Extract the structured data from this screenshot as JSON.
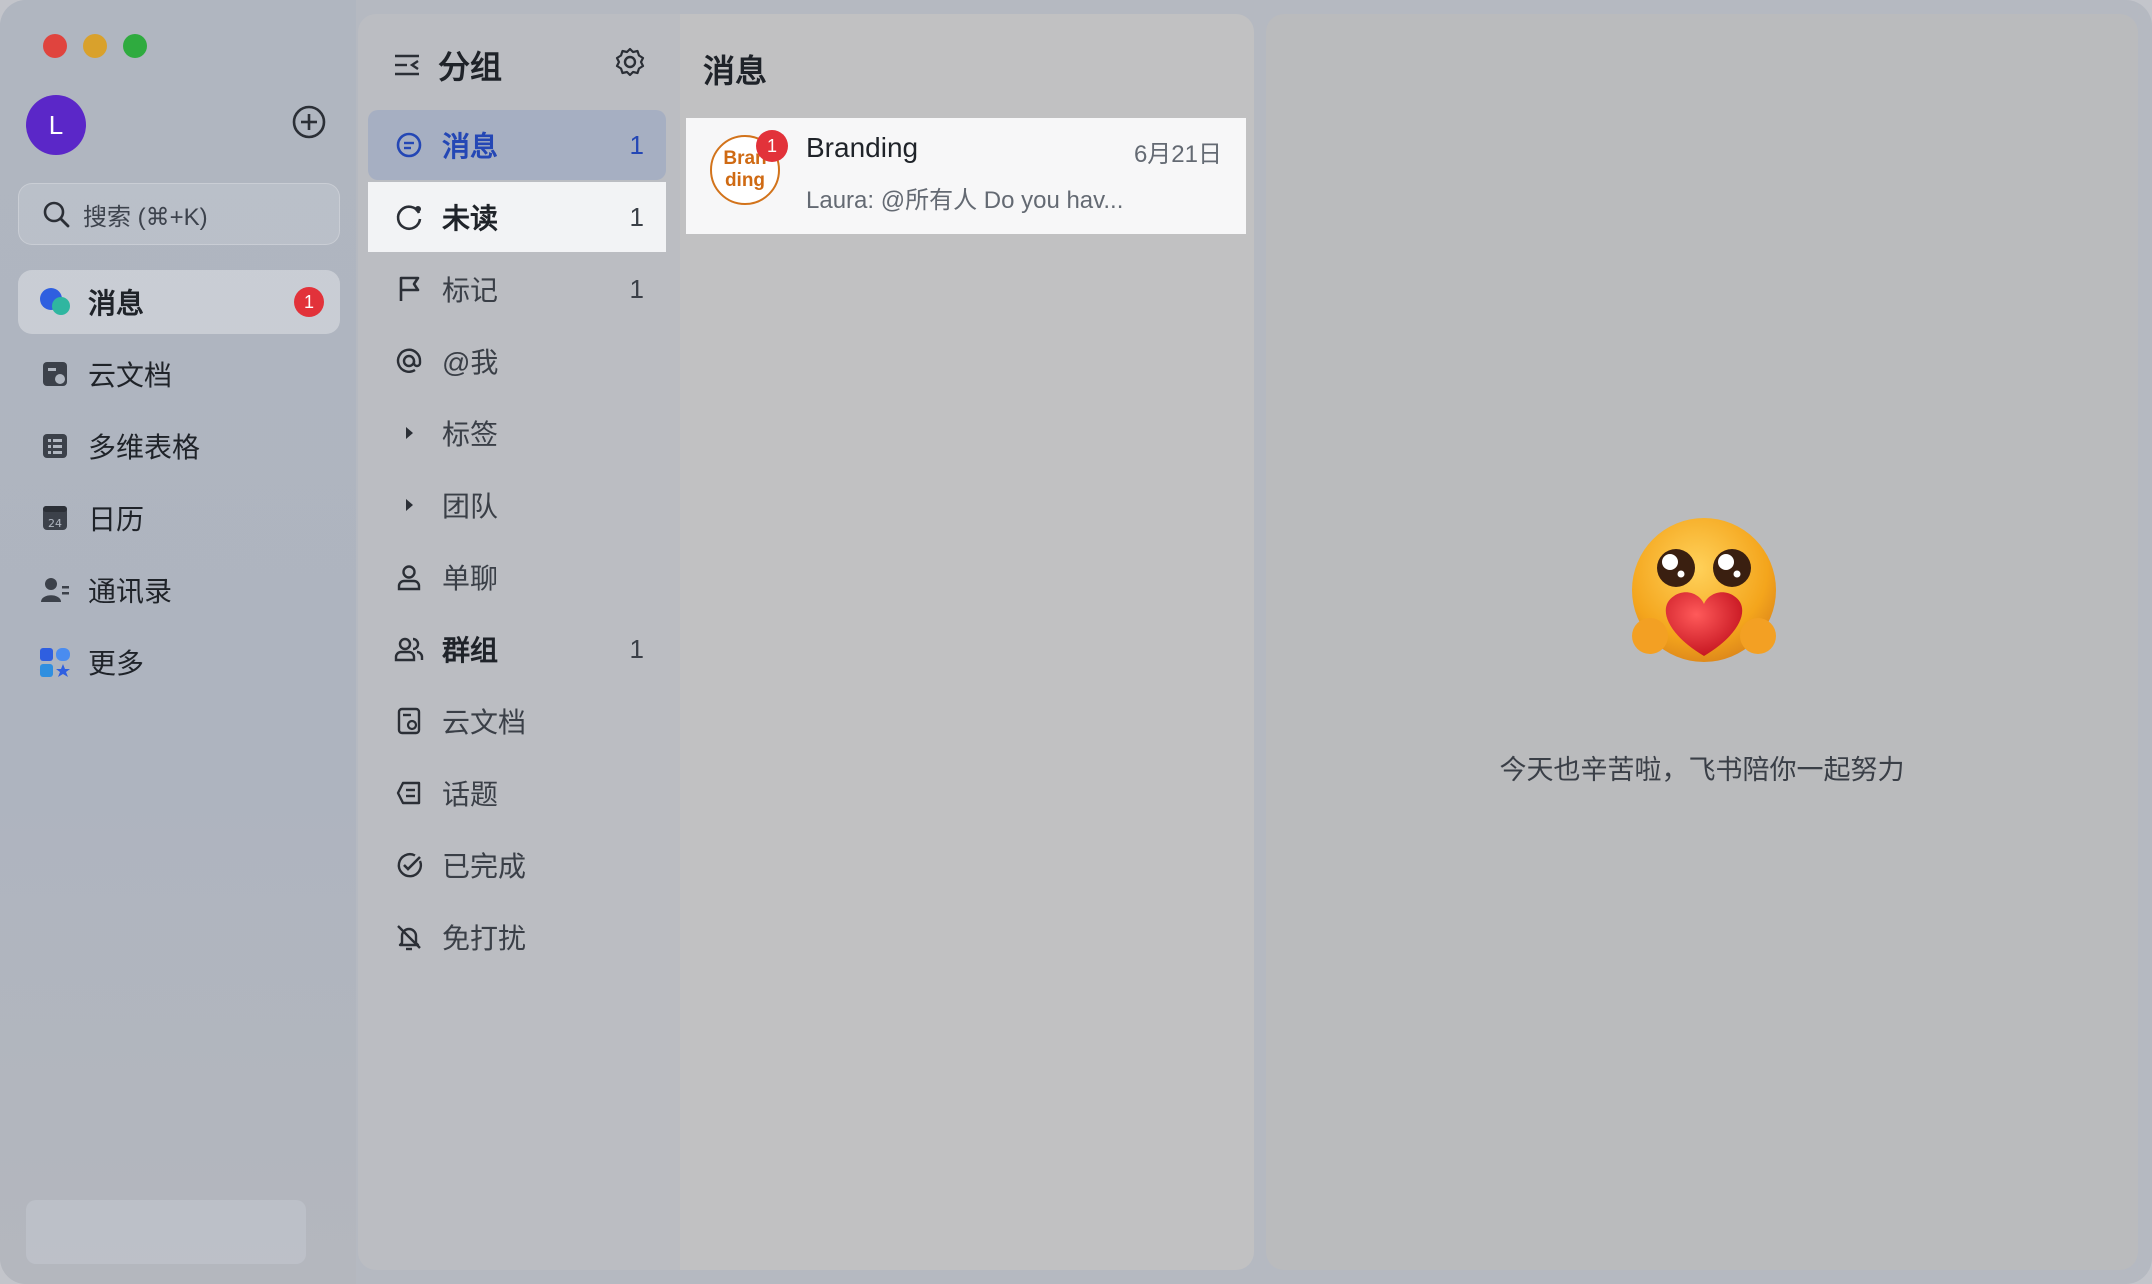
{
  "app": {
    "user_initial": "L",
    "search_placeholder": "搜索 (⌘+K)"
  },
  "sidebar": {
    "items": [
      {
        "label": "消息",
        "icon": "chat-bubbles-icon",
        "active": true,
        "badge": "1"
      },
      {
        "label": "云文档",
        "icon": "cloud-doc-icon"
      },
      {
        "label": "多维表格",
        "icon": "base-table-icon"
      },
      {
        "label": "日历",
        "icon": "calendar-icon"
      },
      {
        "label": "通讯录",
        "icon": "contacts-icon"
      },
      {
        "label": "更多",
        "icon": "more-apps-icon"
      }
    ]
  },
  "groups": {
    "title": "分组",
    "items": [
      {
        "label": "消息",
        "count": "1",
        "icon": "message-icon",
        "state": "selected"
      },
      {
        "label": "未读",
        "count": "1",
        "icon": "unread-icon",
        "state": "hover"
      },
      {
        "label": "标记",
        "count": "1",
        "icon": "flag-icon"
      },
      {
        "label": "@我",
        "count": "",
        "icon": "at-icon"
      },
      {
        "label": "标签",
        "count": "",
        "icon": "caret-right-icon"
      },
      {
        "label": "团队",
        "count": "",
        "icon": "caret-right-icon"
      },
      {
        "label": "单聊",
        "count": "",
        "icon": "person-icon"
      },
      {
        "label": "群组",
        "count": "1",
        "icon": "group-icon",
        "state": "bold"
      },
      {
        "label": "云文档",
        "count": "",
        "icon": "doc-icon"
      },
      {
        "label": "话题",
        "count": "",
        "icon": "topic-icon"
      },
      {
        "label": "已完成",
        "count": "",
        "icon": "done-icon"
      },
      {
        "label": "免打扰",
        "count": "",
        "icon": "mute-bell-icon"
      }
    ]
  },
  "message_list": {
    "title": "消息",
    "messages": [
      {
        "avatar_line1": "Bran",
        "avatar_line2": "ding",
        "unread": "1",
        "name": "Branding",
        "date": "6月21日",
        "preview": "Laura: @所有人 Do you hav..."
      }
    ]
  },
  "detail": {
    "empty_text": "今天也辛苦啦，飞书陪你一起努力"
  },
  "colors": {
    "accent": "#2447b5",
    "badge": "#e2323a",
    "avatar": "#5b27c8",
    "brand_avatar": "#cf6a13"
  }
}
